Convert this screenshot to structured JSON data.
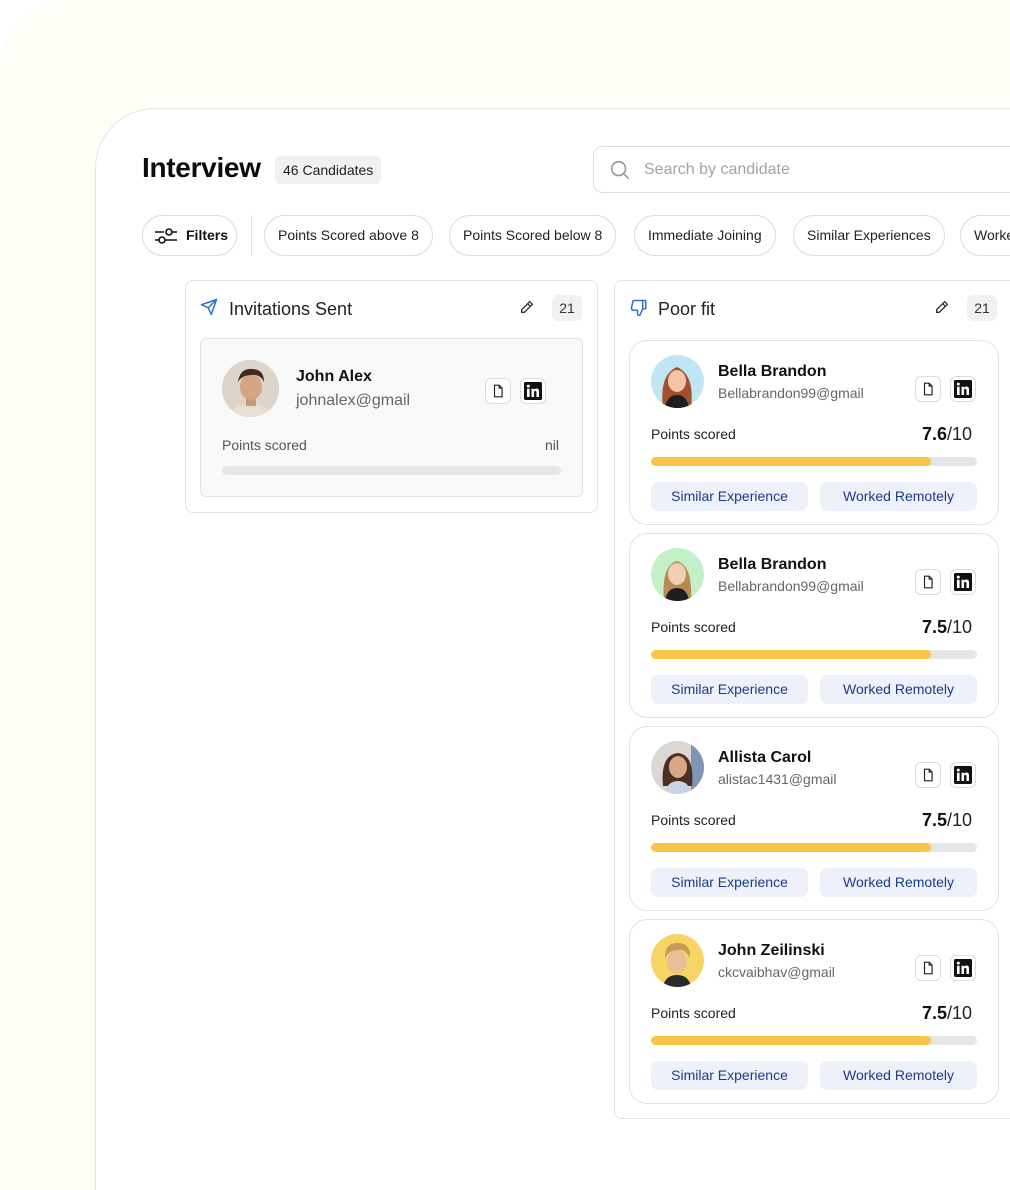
{
  "header": {
    "title": "Interview",
    "candidate_count": "46 Candidates",
    "search_placeholder": "Search by candidate"
  },
  "filters": {
    "filter_label": "Filters",
    "chips": [
      "Points Scored above 8",
      "Points Scored below 8",
      "Immediate Joining",
      "Similar Experiences",
      "Worked Remotely"
    ]
  },
  "columns": [
    {
      "title": "Invitations Sent",
      "count": "21",
      "icon": "send-icon",
      "candidates": [
        {
          "name": "John Alex",
          "email": "johnalex@gmail",
          "points_label": "Points scored",
          "score": "nil",
          "progress": 0
        }
      ]
    },
    {
      "title": "Poor fit",
      "count": "21",
      "icon": "thumbs-down-icon",
      "candidates": [
        {
          "name": "Bella Brandon",
          "email": "Bellabrandon99@gmail",
          "points_label": "Points scored",
          "score": "7.6",
          "out_of": "/10",
          "progress": 0.86,
          "tags": [
            "Similar Experience",
            "Worked Remotely"
          ]
        },
        {
          "name": "Bella Brandon",
          "email": "Bellabrandon99@gmail",
          "points_label": "Points scored",
          "score": "7.5",
          "out_of": "/10",
          "progress": 0.86,
          "tags": [
            "Similar Experience",
            "Worked Remotely"
          ]
        },
        {
          "name": "Allista Carol",
          "email": "alistac1431@gmail",
          "points_label": "Points scored",
          "score": "7.5",
          "out_of": "/10",
          "progress": 0.86,
          "tags": [
            "Similar Experience",
            "Worked Remotely"
          ]
        },
        {
          "name": "John Zeilinski",
          "email": "ckcvaibhav@gmail",
          "points_label": "Points scored",
          "score": "7.5",
          "out_of": "/10",
          "progress": 0.86,
          "tags": [
            "Similar Experience",
            "Worked Remotely"
          ]
        }
      ]
    }
  ],
  "colors": {
    "accent_bar": "#f8c547",
    "tag_bg": "#eef1fa",
    "tag_text": "#1d3a8a",
    "icon_blue": "#2f6fd6"
  }
}
